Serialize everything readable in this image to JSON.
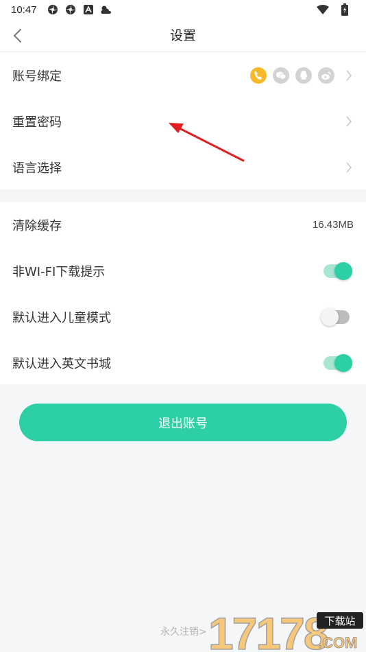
{
  "status_bar": {
    "time": "10:47",
    "icons": [
      "pinwheel-icon",
      "pinwheel-icon",
      "app-a-icon",
      "weather-icon"
    ],
    "right_icons": [
      "wifi-icon",
      "battery-charging-icon"
    ]
  },
  "nav": {
    "title": "设置",
    "back_icon": "chevron-left-icon"
  },
  "account": {
    "bind": {
      "label": "账号绑定",
      "icons": [
        "phone-icon",
        "wechat-icon",
        "qq-icon",
        "weibo-icon"
      ],
      "active_color": "#f6b928",
      "inactive_color": "#d3d3d3"
    },
    "reset_password": {
      "label": "重置密码"
    },
    "language": {
      "label": "语言选择"
    }
  },
  "prefs": {
    "clear_cache": {
      "label": "清除缓存",
      "value": "16.43MB"
    },
    "non_wifi_prompt": {
      "label": "非WI-FI下载提示",
      "on": true
    },
    "kids_mode": {
      "label": "默认进入儿童模式",
      "on": false
    },
    "english_store": {
      "label": "默认进入英文书城",
      "on": true
    }
  },
  "logout_label": "退出账号",
  "permanent_delete_label": "永久注销>",
  "colors": {
    "accent": "#2ccfa6",
    "annotation_arrow": "#e02020"
  },
  "watermark": {
    "number": "17178",
    "tag": "下载站",
    "domain": ".COM"
  }
}
